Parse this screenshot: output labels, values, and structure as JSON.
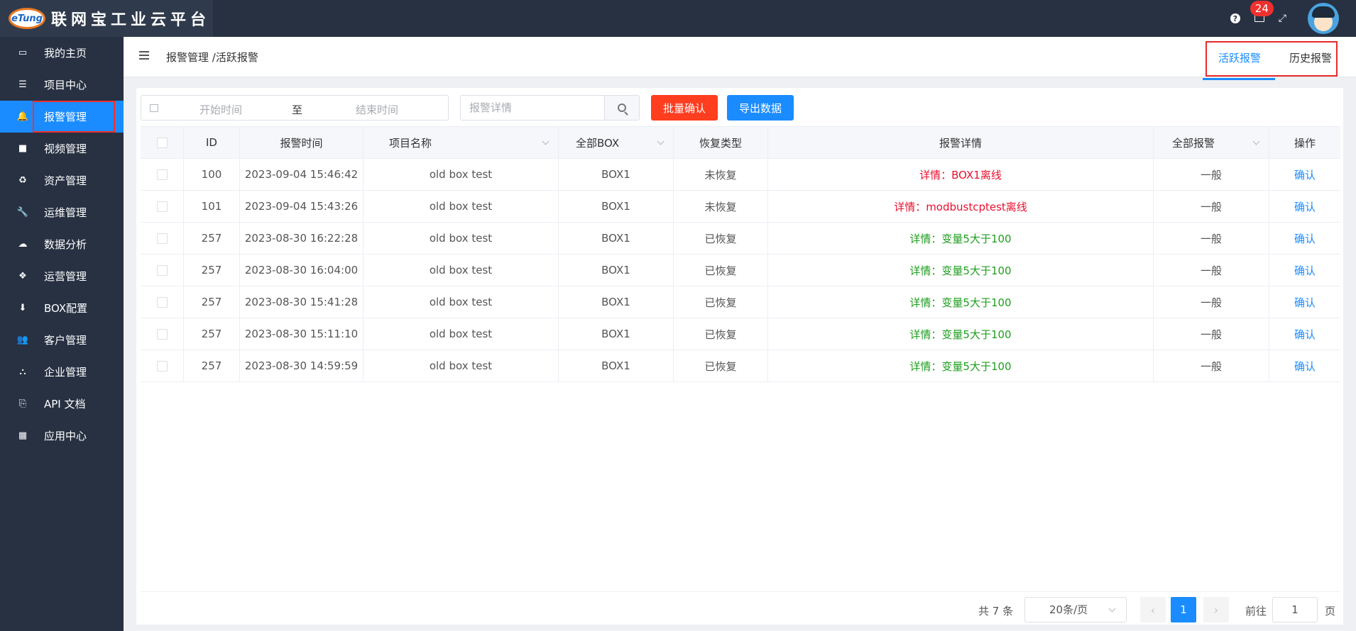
{
  "app": {
    "logo_mark": "eTung",
    "title": "联网宝工业云平台"
  },
  "topbar": {
    "help_icon": "?",
    "notification_count": "24",
    "fullscreen_icon": "⤢"
  },
  "sidebar": {
    "items": [
      {
        "label": "我的主页",
        "icon": "laptop-icon",
        "glyph": "▭"
      },
      {
        "label": "项目中心",
        "icon": "list-icon",
        "glyph": "☰"
      },
      {
        "label": "报警管理",
        "icon": "bell-icon",
        "glyph": "🔔"
      },
      {
        "label": "视频管理",
        "icon": "video-icon",
        "glyph": "■"
      },
      {
        "label": "资产管理",
        "icon": "recycle-icon",
        "glyph": "♻"
      },
      {
        "label": "运维管理",
        "icon": "wrench-icon",
        "glyph": "🔧"
      },
      {
        "label": "数据分析",
        "icon": "cloud-chart-icon",
        "glyph": "☁"
      },
      {
        "label": "运营管理",
        "icon": "cubes-icon",
        "glyph": "❖"
      },
      {
        "label": "BOX配置",
        "icon": "download-icon",
        "glyph": "⬇"
      },
      {
        "label": "客户管理",
        "icon": "users-icon",
        "glyph": "👥"
      },
      {
        "label": "企业管理",
        "icon": "sitemap-icon",
        "glyph": "⛬"
      },
      {
        "label": "API 文档",
        "icon": "doc-search-icon",
        "glyph": "⎘"
      },
      {
        "label": "应用中心",
        "icon": "grid-icon",
        "glyph": "▦"
      }
    ]
  },
  "header": {
    "breadcrumb": "报警管理 /活跃报警",
    "tabs": [
      {
        "label": "活跃报警"
      },
      {
        "label": "历史报警"
      }
    ]
  },
  "filters": {
    "start_placeholder": "开始时间",
    "separator": "至",
    "end_placeholder": "结束时间",
    "search_placeholder": "报警详情",
    "batch_confirm": "批量确认",
    "export": "导出数据"
  },
  "table": {
    "headers": [
      "ID",
      "报警时间",
      "项目名称",
      "全部BOX",
      "恢复类型",
      "报警详情",
      "全部报警",
      "操作"
    ],
    "rows": [
      {
        "id": "100",
        "time": "2023-09-04 15:46:42",
        "project": "old box test",
        "box": "BOX1",
        "recovery": "未恢复",
        "detail": "详情：BOX1离线",
        "level": "一般",
        "action": "确认"
      },
      {
        "id": "101",
        "time": "2023-09-04 15:43:26",
        "project": "old box test",
        "box": "BOX1",
        "recovery": "未恢复",
        "detail": "详情：modbustcptest离线",
        "level": "一般",
        "action": "确认"
      },
      {
        "id": "257",
        "time": "2023-08-30 16:22:28",
        "project": "old box test",
        "box": "BOX1",
        "recovery": "已恢复",
        "detail": "详情：变量5大于100",
        "level": "一般",
        "action": "确认"
      },
      {
        "id": "257",
        "time": "2023-08-30 16:04:00",
        "project": "old box test",
        "box": "BOX1",
        "recovery": "已恢复",
        "detail": "详情：变量5大于100",
        "level": "一般",
        "action": "确认"
      },
      {
        "id": "257",
        "time": "2023-08-30 15:41:28",
        "project": "old box test",
        "box": "BOX1",
        "recovery": "已恢复",
        "detail": "详情：变量5大于100",
        "level": "一般",
        "action": "确认"
      },
      {
        "id": "257",
        "time": "2023-08-30 15:11:10",
        "project": "old box test",
        "box": "BOX1",
        "recovery": "已恢复",
        "detail": "详情：变量5大于100",
        "level": "一般",
        "action": "确认"
      },
      {
        "id": "257",
        "time": "2023-08-30 14:59:59",
        "project": "old box test",
        "box": "BOX1",
        "recovery": "已恢复",
        "detail": "详情：变量5大于100",
        "level": "一般",
        "action": "确认"
      }
    ]
  },
  "pagination": {
    "total": "共 7 条",
    "page_size": "20条/页",
    "prev": "‹",
    "current_page": "1",
    "next": "›",
    "goto_label": "前往",
    "goto_value": "1",
    "page_suffix": "页"
  },
  "colors": {
    "topbar": "#273142",
    "accent": "#1a8cff",
    "danger_button": "#ff3d1f",
    "unrecovered_detail": "#e8102f",
    "recovered_detail": "#1e9e1e",
    "annotation_box": "#e82a2a"
  }
}
